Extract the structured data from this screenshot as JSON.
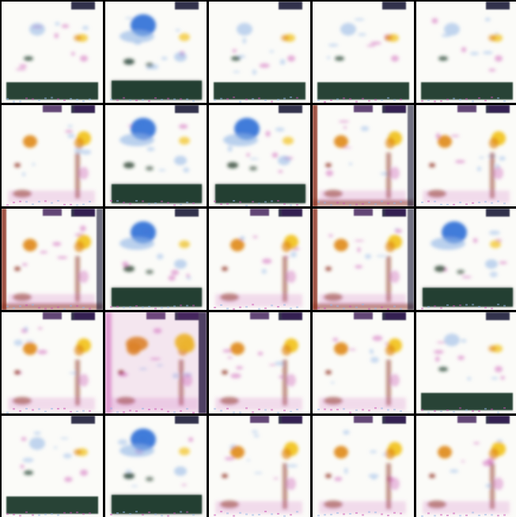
{
  "grid": {
    "rows": 5,
    "cols": 5
  },
  "colors": {
    "background": "#000000",
    "tile_base": "#fbfbf8",
    "blue": "#2f6fd6",
    "light_blue": "#8fb4e6",
    "dark_green": "#1f3a2a",
    "orange": "#e08a1a",
    "yellow": "#f2c21a",
    "red_brown": "#8a2a1a",
    "magenta": "#c94fb2",
    "purple": "#3b1a56",
    "navy": "#0b1230"
  },
  "tiles": [
    [
      "A",
      "B",
      "A",
      "A",
      "A"
    ],
    [
      "C",
      "B",
      "B2",
      "D",
      "C"
    ],
    [
      "D",
      "B",
      "C",
      "D",
      "B2"
    ],
    [
      "C",
      "E",
      "C",
      "C",
      "A"
    ],
    [
      "A",
      "B2",
      "C",
      "C",
      "C"
    ]
  ]
}
